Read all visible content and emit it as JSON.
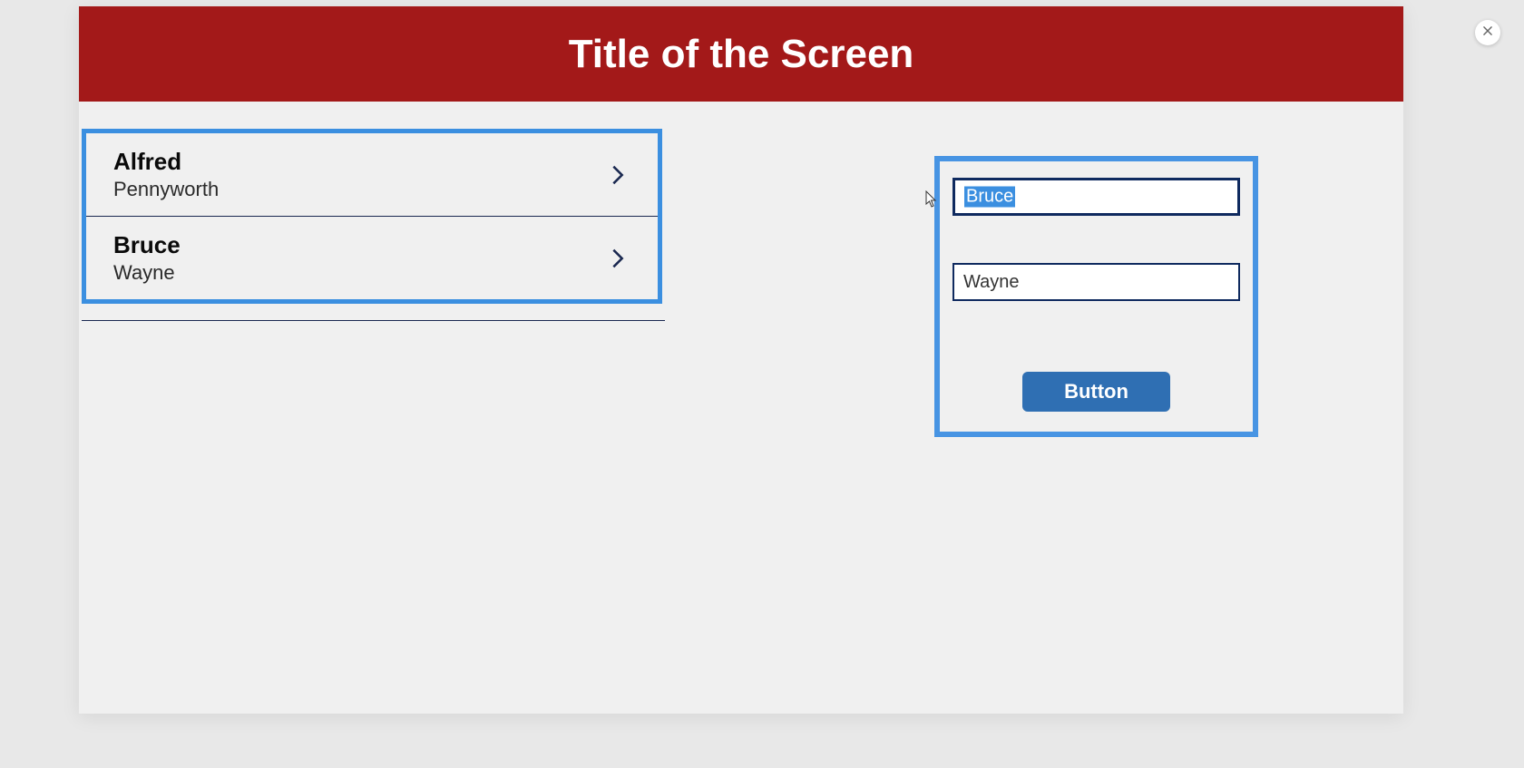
{
  "header": {
    "title": "Title of the Screen"
  },
  "list": {
    "items": [
      {
        "title": "Alfred",
        "subtitle": "Pennyworth"
      },
      {
        "title": "Bruce",
        "subtitle": "Wayne"
      }
    ]
  },
  "form": {
    "field1_value": "Bruce",
    "field2_value": "Wayne",
    "button_label": "Button"
  }
}
